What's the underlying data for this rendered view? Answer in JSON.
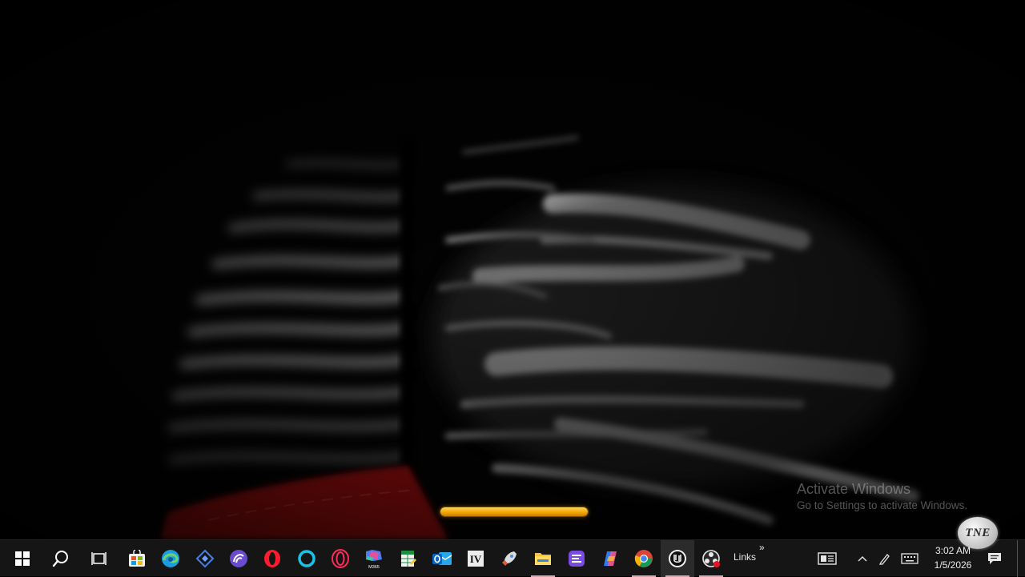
{
  "overlay": {
    "watermark_title": "Activate Windows",
    "watermark_subtitle": "Go to Settings to activate Windows.",
    "logo_text": "TNE",
    "loading_progress_percent": 100,
    "loading_color": "#f0a300"
  },
  "taskbar": {
    "background": "#151515",
    "apps": [
      {
        "id": "start",
        "icon": "windows-logo-icon"
      },
      {
        "id": "search",
        "icon": "search-icon"
      },
      {
        "id": "task-view",
        "icon": "task-view-icon"
      },
      {
        "id": "microsoft-store",
        "icon": "store-icon"
      },
      {
        "id": "edge",
        "icon": "edge-icon"
      },
      {
        "id": "feedly-app",
        "icon": "diamond-app-icon"
      },
      {
        "id": "bittorrent",
        "icon": "bittorrent-icon"
      },
      {
        "id": "opera",
        "icon": "opera-icon"
      },
      {
        "id": "cortana",
        "icon": "cortana-icon"
      },
      {
        "id": "opera-gx",
        "icon": "opera-gx-icon"
      },
      {
        "id": "m365-copilot",
        "icon": "m365-icon"
      },
      {
        "id": "excel-file",
        "icon": "spreadsheet-icon"
      },
      {
        "id": "outlook",
        "icon": "outlook-icon"
      },
      {
        "id": "nv-app",
        "icon": "nv-icon"
      },
      {
        "id": "rocket-app",
        "icon": "rocket-icon"
      },
      {
        "id": "file-explorer",
        "icon": "folder-icon"
      },
      {
        "id": "menu-app",
        "icon": "menu-app-icon"
      },
      {
        "id": "copilot",
        "icon": "copilot-icon"
      },
      {
        "id": "chrome",
        "icon": "chrome-icon"
      },
      {
        "id": "unreal-engine",
        "icon": "unreal-icon"
      },
      {
        "id": "obs-studio",
        "icon": "obs-icon"
      }
    ],
    "links_label": "Links",
    "links_chevron": "»",
    "tray": {
      "show_hidden_icon": "chevron-up-icon",
      "pen_icon": "pen-icon",
      "keyboard_icon": "keyboard-icon",
      "news_icon": "news-widget-icon",
      "notification_icon": "notification-icon"
    },
    "clock": {
      "time": "3:02 AM",
      "date": "1/5/2026"
    }
  }
}
